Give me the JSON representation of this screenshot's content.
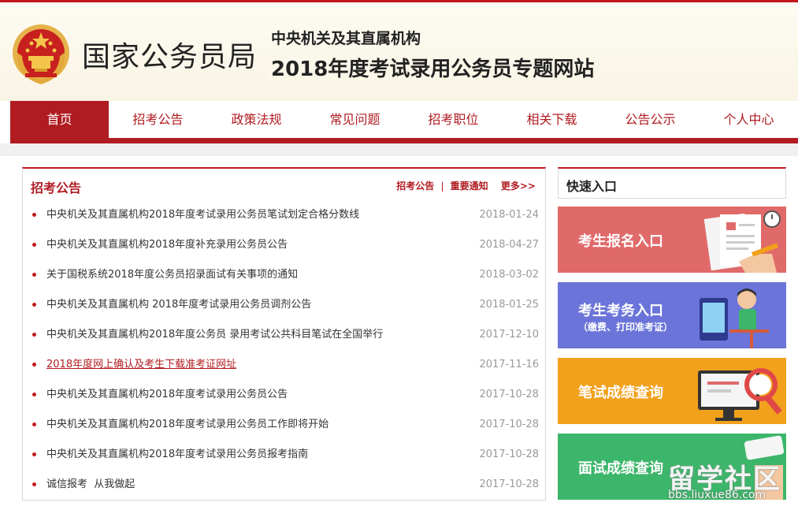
{
  "header": {
    "bureau_name": "国家公务员局",
    "subtitle": "中央机关及其直属机构",
    "title": "2018年度考试录用公务员专题网站",
    "emblem_icon": "national-emblem-icon"
  },
  "nav": {
    "items": [
      "首页",
      "招考公告",
      "政策法规",
      "常见问题",
      "招考职位",
      "相关下载",
      "公告公示",
      "个人中心"
    ],
    "active_index": 0
  },
  "notices": {
    "title": "招考公告",
    "link_1": "招考公告",
    "separator": "|",
    "link_2": "重要通知",
    "more": "更多>>",
    "items": [
      {
        "text": "中央机关及其直属机构2018年度考试录用公务员笔试划定合格分数线",
        "date": "2018-01-24"
      },
      {
        "text": "中央机关及其直属机构2018年度补充录用公务员公告",
        "date": "2018-04-27"
      },
      {
        "text": "关于国税系统2018年度公务员招录面试有关事项的通知",
        "date": "2018-03-02"
      },
      {
        "text": "中央机关及其直属机构 2018年度考试录用公务员调剂公告",
        "date": "2018-01-25"
      },
      {
        "text": "中央机关及其直属机构2018年度公务员 录用考试公共科目笔试在全国举行",
        "date": "2017-12-10"
      },
      {
        "text": "2018年度网上确认及考生下载准考证网址",
        "date": "2017-11-16"
      },
      {
        "text": "中央机关及其直属机构2018年度考试录用公务员公告",
        "date": "2017-10-28"
      },
      {
        "text": "中央机关及其直属机构2018年度考试录用公务员工作即将开始",
        "date": "2017-10-28"
      },
      {
        "text": "中央机关及其直属机构2018年度考试录用公务员报考指南",
        "date": "2017-10-28"
      },
      {
        "text": "诚信报考  从我做起",
        "date": "2017-10-28"
      }
    ],
    "highlighted_index": 5
  },
  "quick": {
    "title": "快速入口",
    "tiles": [
      {
        "label": "考生报名入口",
        "sub": "",
        "color": "#e06a6a"
      },
      {
        "label": "考生考务入口",
        "sub": "（缴费、打印准考证）",
        "color": "#6b74d9"
      },
      {
        "label": "笔试成绩查询",
        "sub": "",
        "color": "#f2a11c"
      },
      {
        "label": "面试成绩查询",
        "sub": "",
        "color": "#3cb66a"
      }
    ]
  },
  "watermark": {
    "text": "留学社区",
    "url": "bbs.liuxue86.com"
  },
  "colors": {
    "brand_red": "#b01c22",
    "bg_header": "#f9f4e4"
  }
}
